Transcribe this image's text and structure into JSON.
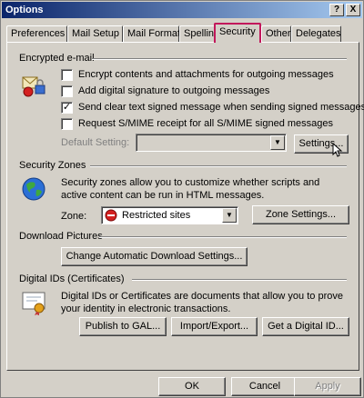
{
  "window": {
    "title": "Options",
    "help_btn": "?",
    "close_btn": "X"
  },
  "tabs": [
    {
      "label": "Preferences"
    },
    {
      "label": "Mail Setup"
    },
    {
      "label": "Mail Format"
    },
    {
      "label": "Spelling"
    },
    {
      "label": "Security"
    },
    {
      "label": "Other"
    },
    {
      "label": "Delegates"
    }
  ],
  "encrypted": {
    "title": "Encrypted e-mail",
    "options": [
      {
        "label": "Encrypt contents and attachments for outgoing messages",
        "checked": false
      },
      {
        "label": "Add digital signature to outgoing messages",
        "checked": false
      },
      {
        "label": "Send clear text signed message when sending signed messages",
        "checked": true
      },
      {
        "label": "Request S/MIME receipt for all S/MIME signed messages",
        "checked": false
      }
    ],
    "default_setting_label": "Default Setting:",
    "settings_button": "Settings..."
  },
  "zones": {
    "title": "Security Zones",
    "description": "Security zones allow you to customize whether scripts and active content can be run in HTML messages.",
    "zone_label": "Zone:",
    "zone_value": "Restricted sites",
    "zone_settings_button": "Zone Settings..."
  },
  "downloads": {
    "title": "Download Pictures",
    "button": "Change Automatic Download Settings..."
  },
  "digital_ids": {
    "title": "Digital IDs (Certificates)",
    "description": "Digital IDs or Certificates are documents that allow you to prove your identity in electronic transactions.",
    "publish_button": "Publish to GAL...",
    "import_button": "Import/Export...",
    "get_button": "Get a Digital ID..."
  },
  "footer": {
    "ok": "OK",
    "cancel": "Cancel",
    "apply": "Apply"
  }
}
